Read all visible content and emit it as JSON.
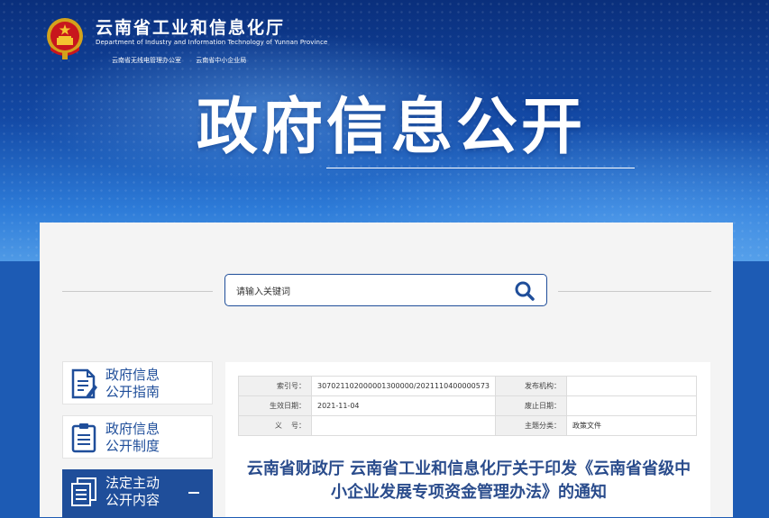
{
  "header": {
    "org_name_cn": "云南省工业和信息化厅",
    "org_name_en": "Department of Industry and Information Technology of Yunnan Province",
    "sub_offices": [
      "云南省无线电管理办公室",
      "云南省中小企业局"
    ],
    "emblem_icon": "national-emblem-icon"
  },
  "hero": {
    "title": "政府信息公开"
  },
  "search": {
    "placeholder": "请输入关键词",
    "icon": "search-icon"
  },
  "sidebar": {
    "items": [
      {
        "label_line1": "政府信息",
        "label_line2": "公开指南",
        "icon": "guide-document-icon",
        "active": false
      },
      {
        "label_line1": "政府信息",
        "label_line2": "公开制度",
        "icon": "clipboard-icon",
        "active": false
      },
      {
        "label_line1": "法定主动",
        "label_line2": "公开内容",
        "icon": "documents-icon",
        "active": true
      }
    ]
  },
  "meta": {
    "rows": [
      {
        "k1": "索引号：",
        "v1": "307021102000001300000/2021110400000573",
        "k2": "发布机构：",
        "v2": ""
      },
      {
        "k1": "生效日期：",
        "v1": "2021-11-04",
        "k2": "废止日期：",
        "v2": ""
      },
      {
        "k1": "义    号：",
        "v1": "",
        "k2": "主题分类：",
        "v2": "政策文件"
      }
    ]
  },
  "document": {
    "title": "云南省财政厅 云南省工业和信息化厅关于印发《云南省省级中小企业发展专项资金管理办法》的通知"
  },
  "colors": {
    "accent": "#1f4e9a",
    "title": "#2a4c8c",
    "banner": "#1349a5"
  }
}
